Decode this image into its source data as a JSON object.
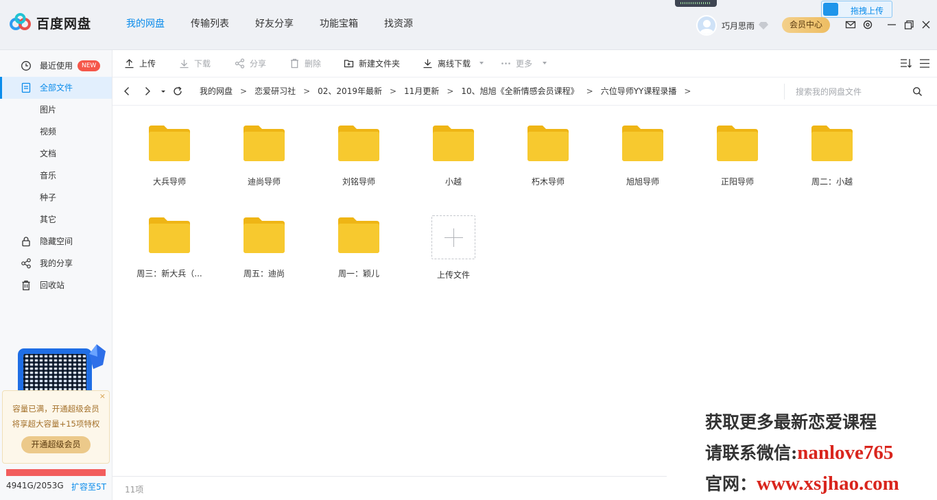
{
  "app": {
    "name": "百度网盘",
    "nav": [
      "我的网盘",
      "传输列表",
      "好友分享",
      "功能宝箱",
      "找资源"
    ],
    "drag_upload": "拖拽上传",
    "user_name": "巧月思雨",
    "vip_center": "会员中心"
  },
  "sidebar": {
    "items": [
      {
        "label": "最近使用",
        "badge": "NEW"
      },
      {
        "label": "全部文件"
      },
      {
        "label": "图片"
      },
      {
        "label": "视频"
      },
      {
        "label": "文档"
      },
      {
        "label": "音乐"
      },
      {
        "label": "种子"
      },
      {
        "label": "其它"
      },
      {
        "label": "隐藏空间"
      },
      {
        "label": "我的分享"
      },
      {
        "label": "回收站"
      }
    ],
    "promo": {
      "close": "×",
      "line1": "容量已满，开通超级会员",
      "line2": "将享超大容量+15项特权",
      "button": "开通超级会员"
    },
    "quota_text": "4941G/2053G",
    "expand": "扩容至5T"
  },
  "toolbar": {
    "upload": "上传",
    "download": "下载",
    "share": "分享",
    "delete": "删除",
    "new_folder": "新建文件夹",
    "offline": "离线下载",
    "more": "更多"
  },
  "breadcrumb": [
    "我的网盘",
    "恋爱研习社",
    "02、2019年最新",
    "11月更新",
    "10、旭旭《全新情感会员课程》",
    "六位导师YY课程录播"
  ],
  "search": {
    "placeholder": "搜索我的网盘文件"
  },
  "files": [
    "大兵导师",
    "迪尚导师",
    "刘铭导师",
    "小越",
    "朽木导师",
    "旭旭导师",
    "正阳导师",
    "周二：小越",
    "周三：新大兵（...",
    "周五：迪尚",
    "周一：颖儿"
  ],
  "upload_tile": "上传文件",
  "status": {
    "count": "11项"
  },
  "watermark": {
    "line1": "获取更多最新恋爱课程",
    "line2_prefix": "请联系微信:",
    "line2_value": "nanlove765",
    "line3_prefix": "官网：",
    "line3_value": "www.xsjhao.com"
  },
  "colors": {
    "accent": "#0b8ceb",
    "folder": "#f7c430",
    "quota_full": "#f25d5d",
    "watermark_red": "#d9251d"
  }
}
